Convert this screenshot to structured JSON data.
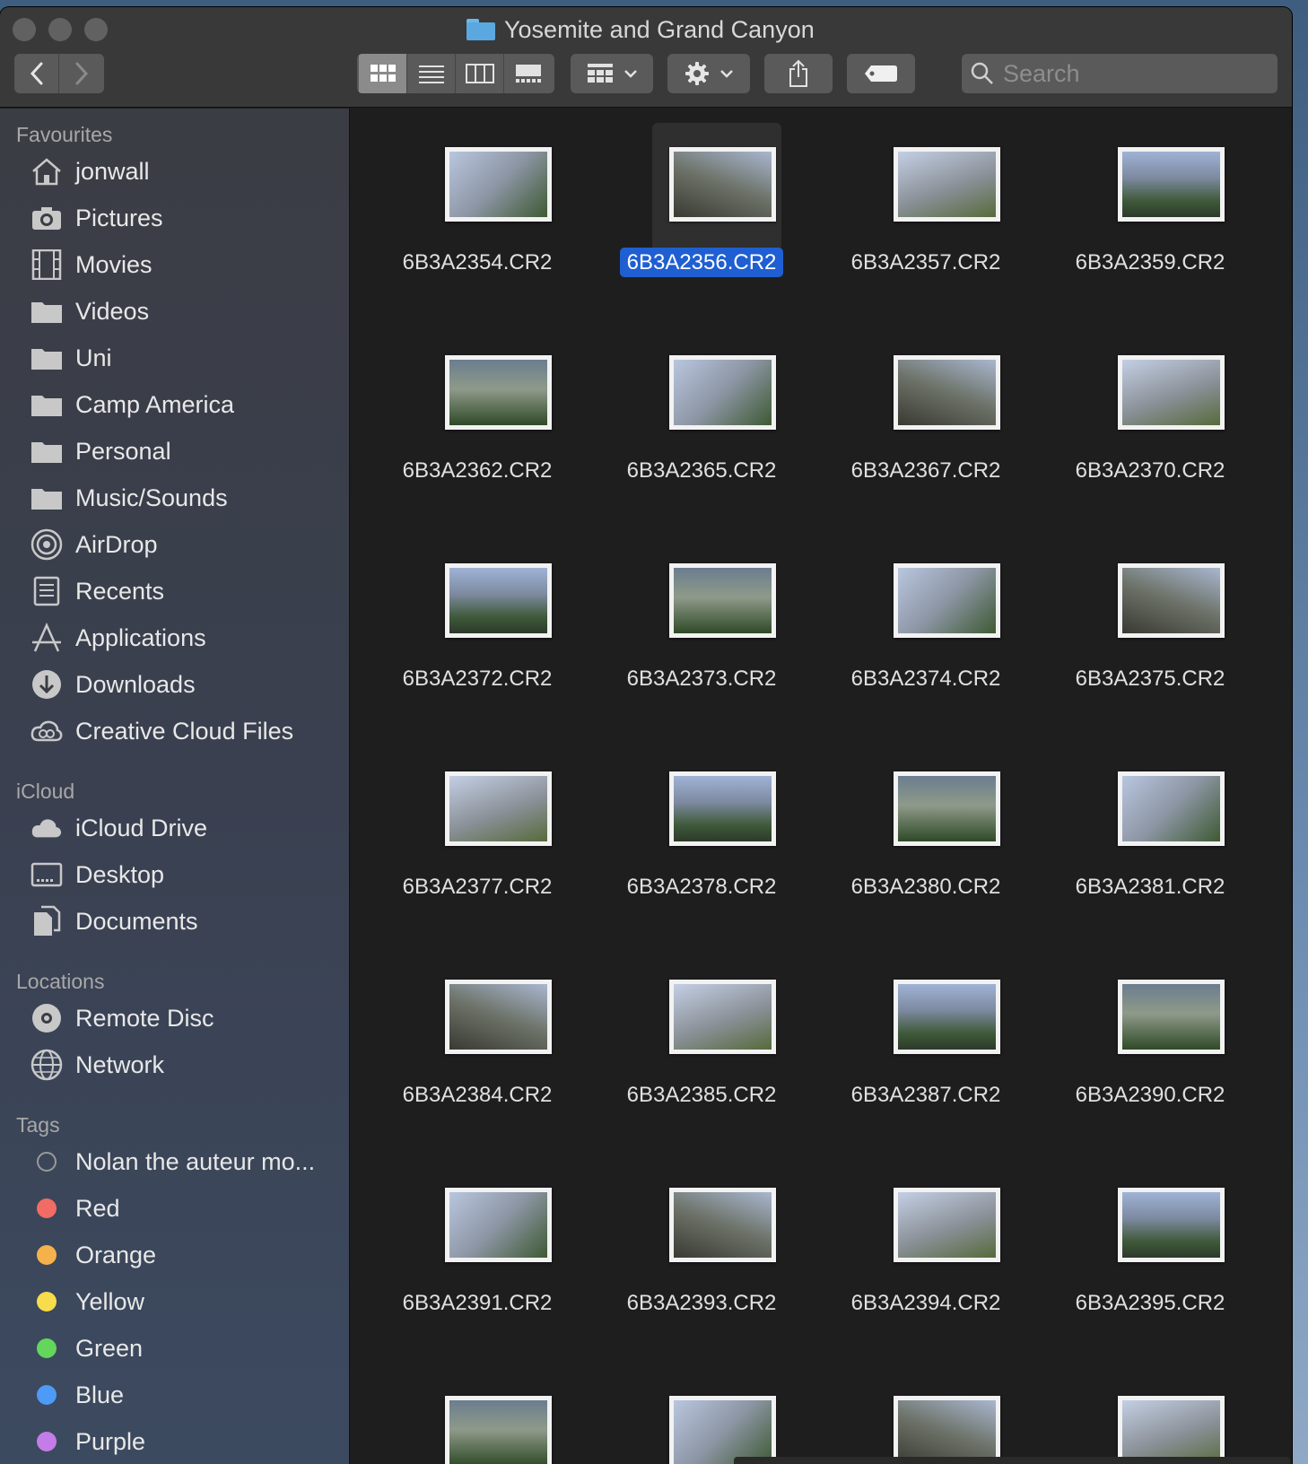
{
  "window": {
    "title": "Yosemite and Grand Canyon",
    "search_placeholder": "Search"
  },
  "sidebar": {
    "favourites_header": "Favourites",
    "favourites": [
      {
        "label": "jonwall",
        "icon": "home-icon"
      },
      {
        "label": "Pictures",
        "icon": "camera-icon"
      },
      {
        "label": "Movies",
        "icon": "film-icon"
      },
      {
        "label": "Videos",
        "icon": "folder-icon"
      },
      {
        "label": "Uni",
        "icon": "folder-icon"
      },
      {
        "label": "Camp America",
        "icon": "folder-icon"
      },
      {
        "label": "Personal",
        "icon": "folder-icon"
      },
      {
        "label": "Music/Sounds",
        "icon": "folder-icon"
      },
      {
        "label": "AirDrop",
        "icon": "airdrop-icon"
      },
      {
        "label": "Recents",
        "icon": "recents-icon"
      },
      {
        "label": "Applications",
        "icon": "applications-icon"
      },
      {
        "label": "Downloads",
        "icon": "download-icon"
      },
      {
        "label": "Creative Cloud Files",
        "icon": "creative-cloud-icon"
      }
    ],
    "icloud_header": "iCloud",
    "icloud": [
      {
        "label": "iCloud Drive",
        "icon": "cloud-icon"
      },
      {
        "label": "Desktop",
        "icon": "desktop-icon"
      },
      {
        "label": "Documents",
        "icon": "documents-icon"
      }
    ],
    "locations_header": "Locations",
    "locations": [
      {
        "label": "Remote Disc",
        "icon": "disc-icon"
      },
      {
        "label": "Network",
        "icon": "globe-icon"
      }
    ],
    "tags_header": "Tags",
    "tags": [
      {
        "label": "Nolan the auteur mo...",
        "color": ""
      },
      {
        "label": "Red",
        "color": "#f26b64"
      },
      {
        "label": "Orange",
        "color": "#f5b24b"
      },
      {
        "label": "Yellow",
        "color": "#f7dc4b"
      },
      {
        "label": "Green",
        "color": "#63d65b"
      },
      {
        "label": "Blue",
        "color": "#4e9af7"
      },
      {
        "label": "Purple",
        "color": "#c47ce8"
      }
    ]
  },
  "files": [
    {
      "name": "6B3A2354.CR2"
    },
    {
      "name": "6B3A2356.CR2",
      "selected": true
    },
    {
      "name": "6B3A2357.CR2"
    },
    {
      "name": "6B3A2359.CR2"
    },
    {
      "name": "6B3A2362.CR2"
    },
    {
      "name": "6B3A2365.CR2"
    },
    {
      "name": "6B3A2367.CR2"
    },
    {
      "name": "6B3A2370.CR2"
    },
    {
      "name": "6B3A2372.CR2"
    },
    {
      "name": "6B3A2373.CR2"
    },
    {
      "name": "6B3A2374.CR2"
    },
    {
      "name": "6B3A2375.CR2"
    },
    {
      "name": "6B3A2377.CR2"
    },
    {
      "name": "6B3A2378.CR2"
    },
    {
      "name": "6B3A2380.CR2"
    },
    {
      "name": "6B3A2381.CR2"
    },
    {
      "name": "6B3A2384.CR2"
    },
    {
      "name": "6B3A2385.CR2"
    },
    {
      "name": "6B3A2387.CR2"
    },
    {
      "name": "6B3A2390.CR2"
    },
    {
      "name": "6B3A2391.CR2"
    },
    {
      "name": "6B3A2393.CR2"
    },
    {
      "name": "6B3A2394.CR2"
    },
    {
      "name": "6B3A2395.CR2"
    },
    {
      "name": ""
    },
    {
      "name": ""
    },
    {
      "name": ""
    },
    {
      "name": ""
    }
  ]
}
